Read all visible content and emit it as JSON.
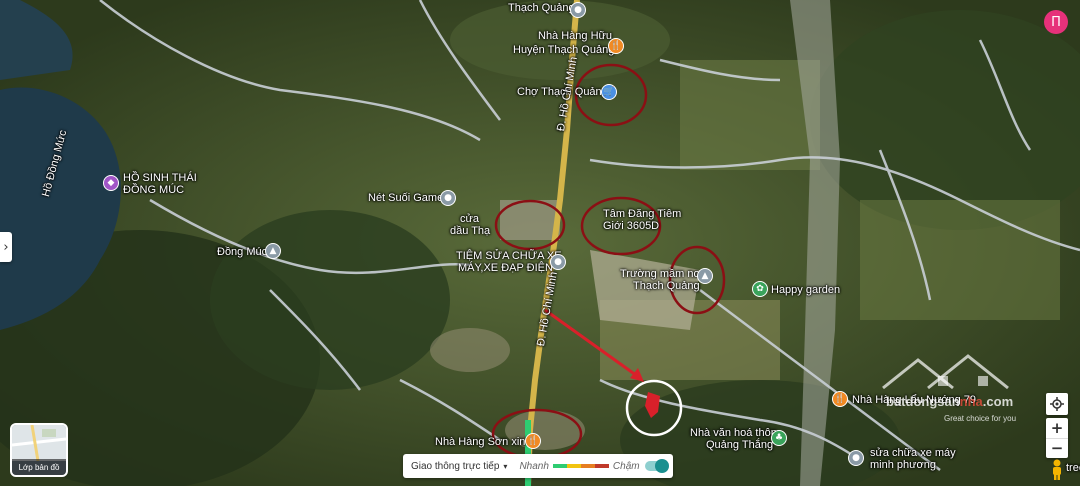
{
  "map": {
    "places": {
      "thach_quang_top": "Thạch Quảng",
      "nha_hang_huu": "Nhà Hàng Hữu",
      "huyen_thach_quang": "Huyện Thạch Quảng",
      "cho_thach_quang": "Chợ Thạch Quảng",
      "ho_sinh_thai": "HỒ SINH THÁI",
      "dong_muc_upper": "ĐỒNG MÚC",
      "ho_dong_muc": "Hồ Đồng Mức",
      "net_suoi_game": "Nét Suối Game",
      "cua_dau_th": "cửa",
      "cua_dau_th2": "dầu Thạ",
      "tam_dang": "Tâm Đăng Tiêm",
      "tam_dang2": "Giới 3605D",
      "dong_muc": "Đồng Múc",
      "tiem_sua_chua": "TIỆM SỬA CHỮA XE",
      "tiem_sua_chua2": "MÁY,XE ĐẠP ĐIỆN",
      "truong_mam_non": "Trường mầm non",
      "truong_mam_non2": "Thạch Quảng",
      "happy_garden": "Happy garden",
      "road_hcm_upper": "Đ. Hồ Chí Minh",
      "road_hcm_lower": "Đ. Hồ Chí Minh",
      "nha_hang_son_xinh": "Nhà Hàng Sơn xinh",
      "nha_hang_lau": "Nhà Hàng Lẩu Nướng 79",
      "nha_van_hoa": "Nhà văn hoá thôn",
      "nha_van_hoa2": "Quảng Thắng",
      "sua_chua_xe": "sửa chữa xe máy",
      "sua_chua_xe2": "minh phương",
      "tree_label": "tree"
    },
    "layer_label": "Lớp bản đồ",
    "traffic": {
      "label": "Giao thông trực tiếp",
      "fast": "Nhanh",
      "slow": "Chậm",
      "colors": [
        "#2ecc71",
        "#f1c40f",
        "#e67e22",
        "#c0392b",
        "#7b1e1e"
      ]
    },
    "watermark": {
      "brand": "batdongsan",
      "brand_bold": "nha",
      "domain": ".com",
      "tagline": "Great choice for you"
    },
    "profile_initial": "Π",
    "controls": {
      "zoom_in": "+",
      "zoom_out": "−",
      "expand_arrow": "›"
    },
    "accent_colors": {
      "highlight_red": "#8b0f14",
      "arrow_red": "#d9202a",
      "road_yellow": "#d4b54a",
      "profile_pink": "#e6317a"
    }
  }
}
